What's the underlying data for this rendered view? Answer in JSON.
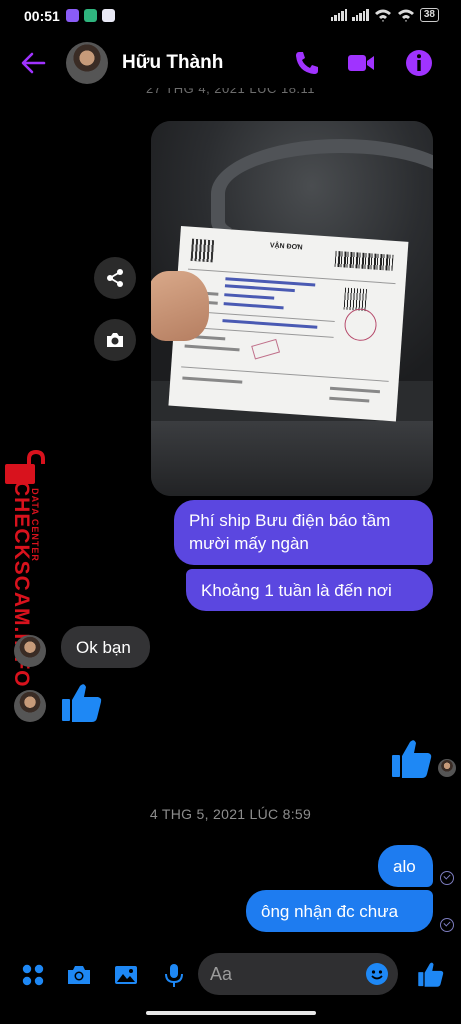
{
  "status_bar": {
    "time": "00:51",
    "battery": "38"
  },
  "header": {
    "contact_name": "Hữu Thành"
  },
  "cut_date": "27 THG 4, 2021 LÚC 18:11",
  "waybill": {
    "title": "VẬN ĐƠN"
  },
  "watermark": {
    "brand": "CHECKSCAM.INFO",
    "sub": "DATA CENTER"
  },
  "messages": [
    {
      "side": "sent",
      "text": "Phí ship Bưu điện báo tầm mười mấy ngàn"
    },
    {
      "side": "sent",
      "text": "Khoảng 1 tuần là đến nơi"
    },
    {
      "side": "received",
      "text": "Ok bạn"
    }
  ],
  "date_separator": "4 THG 5, 2021 LÚC 8:59",
  "later_messages": [
    {
      "side": "sent",
      "text": "alo"
    },
    {
      "side": "sent",
      "text": "ông nhận đc chưa"
    }
  ],
  "composer": {
    "placeholder": "Aa"
  },
  "colors": {
    "accent": "#a033ff",
    "sent_bubble": "#5b47e0",
    "like": "#1e88f5",
    "received_bubble": "#333335"
  }
}
